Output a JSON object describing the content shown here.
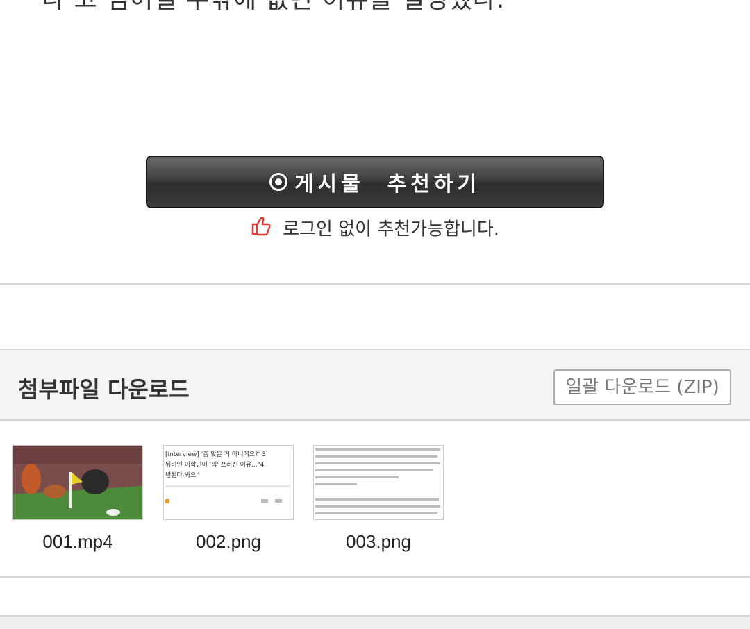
{
  "article": {
    "tail_text": "다 고 넘어질 수밖에 없던 이유를 설명했다."
  },
  "recommend": {
    "button_label": "게시물  추천하기",
    "note": "로그인 없이 추천가능합니다.",
    "accent_color": "#e53935"
  },
  "attachments": {
    "title": "첨부파일 다운로드",
    "zip_label": "일괄 다운로드 (ZIP)",
    "files": [
      {
        "name": "001.mp4",
        "thumb": "soccer-video-thumbnail"
      },
      {
        "name": "002.png",
        "thumb": "article-headline-screenshot",
        "text": [
          "[Interview] '총 맞은 거 아니에요?' 3",
          "뒤비인 이학민이 '픽' 쓰러진 이유...\"4",
          "년된다 봐요\""
        ]
      },
      {
        "name": "003.png",
        "thumb": "article-body-screenshot"
      }
    ]
  }
}
